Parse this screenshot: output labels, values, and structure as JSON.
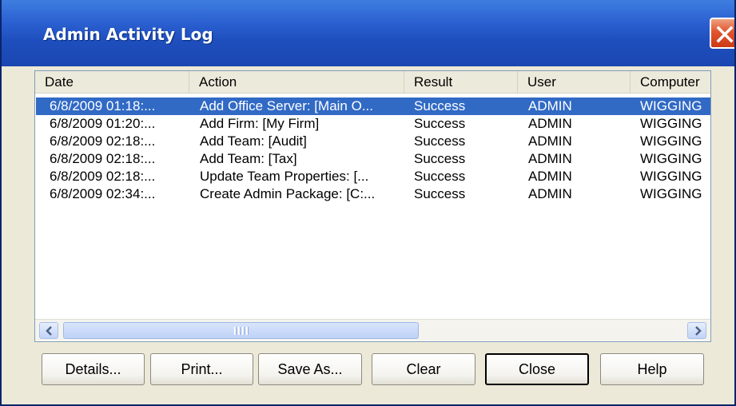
{
  "window": {
    "title": "Admin Activity Log",
    "title_color": "#ffffff",
    "titlebar_color": "#2a5fd0",
    "close_icon": "close-icon"
  },
  "list": {
    "columns": [
      "Date",
      "Action",
      "Result",
      "User",
      "Computer"
    ],
    "selected_row": 0,
    "selection_color": "#316ac5",
    "rows": [
      [
        "6/8/2009 01:18:...",
        "Add Office Server: [Main O...",
        "Success",
        "ADMIN",
        "WIGGING"
      ],
      [
        "6/8/2009 01:20:...",
        "Add Firm: [My Firm]",
        "Success",
        "ADMIN",
        "WIGGING"
      ],
      [
        "6/8/2009 02:18:...",
        "Add Team: [Audit]",
        "Success",
        "ADMIN",
        "WIGGING"
      ],
      [
        "6/8/2009 02:18:...",
        "Add Team: [Tax]",
        "Success",
        "ADMIN",
        "WIGGING"
      ],
      [
        "6/8/2009 02:18:...",
        "Update Team Properties: [...",
        "Success",
        "ADMIN",
        "WIGGING"
      ],
      [
        "6/8/2009 02:34:...",
        "Create Admin Package: [C:...",
        "Success",
        "ADMIN",
        "WIGGING"
      ]
    ],
    "scrollbar": {
      "left_icon": "chevron-left-icon",
      "right_icon": "chevron-right-icon"
    }
  },
  "buttons": {
    "details": "Details...",
    "print": "Print...",
    "save_as": "Save As...",
    "clear": "Clear",
    "close": "Close",
    "help": "Help"
  }
}
